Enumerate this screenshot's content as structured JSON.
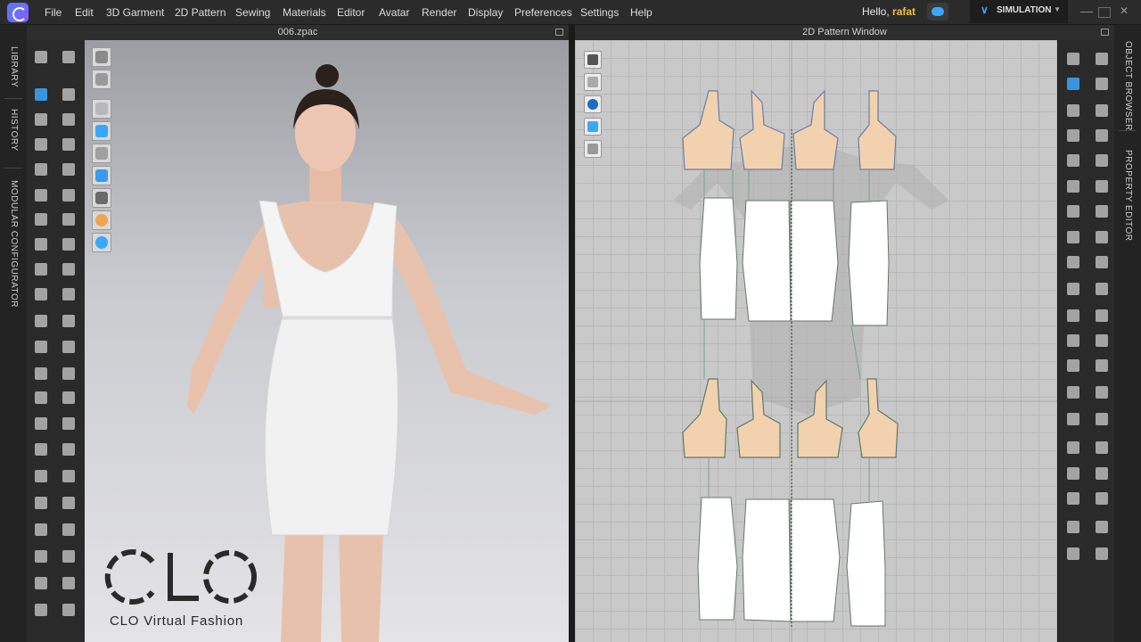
{
  "menu": {
    "items": [
      "File",
      "Edit",
      "3D Garment",
      "2D Pattern",
      "Sewing",
      "Materials",
      "Editor",
      "Avatar",
      "Render",
      "Display",
      "Preferences",
      "Settings",
      "Help"
    ],
    "greeting_prefix": "Hello,",
    "username": "rafat",
    "mode": "SIMULATION"
  },
  "left_tabs": [
    "LIBRARY",
    "HISTORY",
    "MODULAR CONFIGURATOR"
  ],
  "right_tabs": [
    "OBJECT BROWSER",
    "PROPERTY EDITOR"
  ],
  "window_3d": {
    "title": "006.zpac"
  },
  "window_2d": {
    "title": "2D Pattern Window"
  },
  "branding": {
    "logo_text": "CLO",
    "caption": "CLO Virtual Fashion"
  },
  "colors": {
    "accent": "#3aa7ff",
    "bodice": "#f2d2ae",
    "skirt": "#ffffff",
    "username": "#f0c040"
  }
}
